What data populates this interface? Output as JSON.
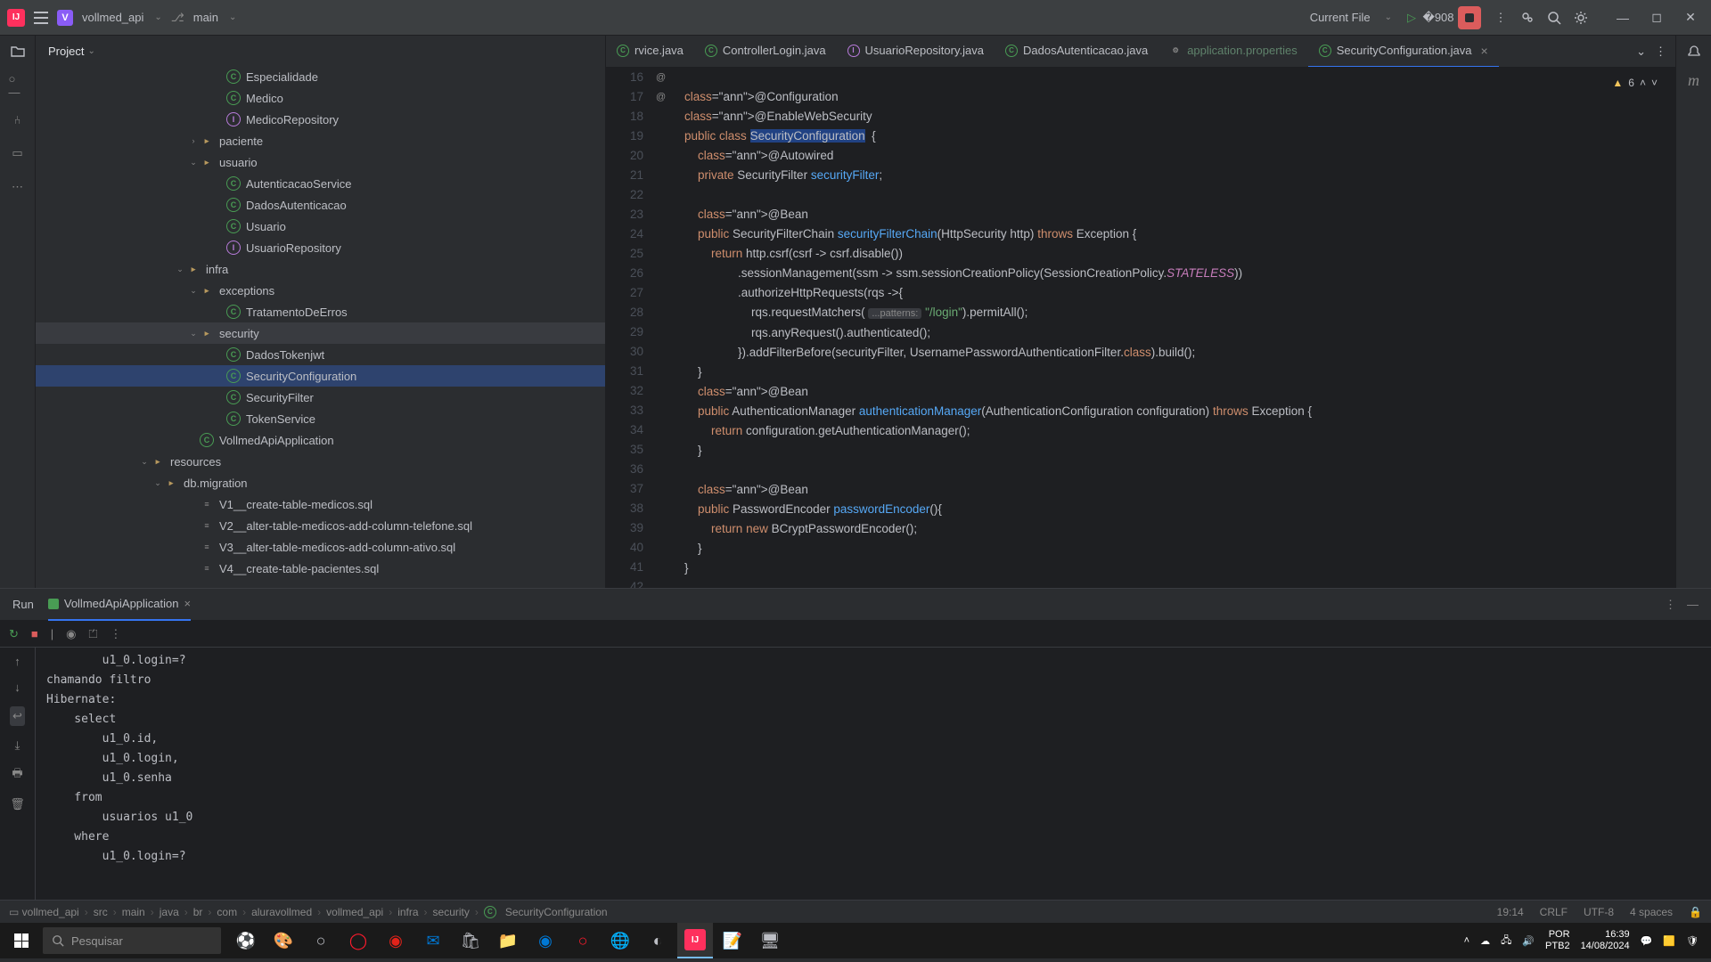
{
  "titlebar": {
    "project": "vollmed_api",
    "branch": "main",
    "run_config": "Current File"
  },
  "panel": {
    "title": "Project"
  },
  "tree": [
    {
      "ind": 200,
      "icon": "class",
      "label": "Especialidade"
    },
    {
      "ind": 200,
      "icon": "class",
      "label": "Medico"
    },
    {
      "ind": 200,
      "icon": "iface",
      "label": "MedicoRepository"
    },
    {
      "ind": 170,
      "chev": "›",
      "icon": "pkg",
      "label": "paciente"
    },
    {
      "ind": 170,
      "chev": "⌄",
      "icon": "pkg",
      "label": "usuario"
    },
    {
      "ind": 200,
      "icon": "class",
      "label": "AutenticacaoService"
    },
    {
      "ind": 200,
      "icon": "class",
      "label": "DadosAutenticacao"
    },
    {
      "ind": 200,
      "icon": "class",
      "label": "Usuario"
    },
    {
      "ind": 200,
      "icon": "iface",
      "label": "UsuarioRepository"
    },
    {
      "ind": 155,
      "chev": "⌄",
      "icon": "pkg",
      "label": "infra"
    },
    {
      "ind": 170,
      "chev": "⌄",
      "icon": "pkg",
      "label": "exceptions"
    },
    {
      "ind": 200,
      "icon": "class",
      "label": "TratamentoDeErros"
    },
    {
      "ind": 170,
      "chev": "⌄",
      "icon": "pkg",
      "label": "security",
      "hl": true
    },
    {
      "ind": 200,
      "icon": "class",
      "label": "DadosTokenjwt"
    },
    {
      "ind": 200,
      "icon": "class",
      "label": "SecurityConfiguration",
      "sel": true
    },
    {
      "ind": 200,
      "icon": "class",
      "label": "SecurityFilter"
    },
    {
      "ind": 200,
      "icon": "class",
      "label": "TokenService"
    },
    {
      "ind": 170,
      "icon": "class",
      "label": "VollmedApiApplication"
    },
    {
      "ind": 115,
      "chev": "⌄",
      "icon": "dir",
      "label": "resources"
    },
    {
      "ind": 130,
      "chev": "⌄",
      "icon": "dir",
      "label": "db.migration"
    },
    {
      "ind": 170,
      "icon": "file",
      "label": "V1__create-table-medicos.sql"
    },
    {
      "ind": 170,
      "icon": "file",
      "label": "V2__alter-table-medicos-add-column-telefone.sql"
    },
    {
      "ind": 170,
      "icon": "file",
      "label": "V3__alter-table-medicos-add-column-ativo.sql"
    },
    {
      "ind": 170,
      "icon": "file",
      "label": "V4__create-table-pacientes.sql"
    }
  ],
  "tabs": [
    {
      "icon": "class",
      "label": "rvice.java"
    },
    {
      "icon": "class",
      "label": "ControllerLogin.java"
    },
    {
      "icon": "iface",
      "label": "UsuarioRepository.java"
    },
    {
      "icon": "class",
      "label": "DadosAutenticacao.java"
    },
    {
      "icon": "prop",
      "label": "application.properties"
    },
    {
      "icon": "class",
      "label": "SecurityConfiguration.java",
      "active": true
    }
  ],
  "warnings": "6",
  "code": {
    "start": 16,
    "lines": [
      "",
      "@Configuration",
      "@EnableWebSecurity",
      "public class SecurityConfiguration  {",
      "    @Autowired",
      "    private SecurityFilter securityFilter;",
      "",
      "    @Bean",
      "    public SecurityFilterChain securityFilterChain(HttpSecurity http) throws Exception {",
      "        return http.csrf(csrf -> csrf.disable())",
      "                .sessionManagement(ssm -> ssm.sessionCreationPolicy(SessionCreationPolicy.STATELESS))",
      "                .authorizeHttpRequests(rqs ->{",
      "                    rqs.requestMatchers( ...patterns: \"/login\").permitAll();",
      "                    rqs.anyRequest().authenticated();",
      "                }).addFilterBefore(securityFilter, UsernamePasswordAuthenticationFilter.class).build();",
      "    }",
      "    @Bean",
      "    public AuthenticationManager authenticationManager(AuthenticationConfiguration configuration) throws Exception {",
      "        return configuration.getAuthenticationManager();",
      "    }",
      "",
      "    @Bean",
      "    public PasswordEncoder passwordEncoder(){",
      "        return new BCryptPasswordEncoder();",
      "    }",
      "}",
      ""
    ]
  },
  "run": {
    "tab": "Run",
    "app": "VollmedApiApplication",
    "console": "        u1_0.login=?\nchamando filtro\nHibernate: \n    select\n        u1_0.id,\n        u1_0.login,\n        u1_0.senha \n    from\n        usuarios u1_0 \n    where\n        u1_0.login=?"
  },
  "breadcrumbs": [
    "vollmed_api",
    "src",
    "main",
    "java",
    "br",
    "com",
    "aluravollmed",
    "vollmed_api",
    "infra",
    "security",
    "SecurityConfiguration"
  ],
  "status": {
    "pos": "19:14",
    "sep": "CRLF",
    "enc": "UTF-8",
    "indent": "4 spaces"
  },
  "taskbar": {
    "search": "Pesquisar",
    "lang": "POR",
    "kb": "PTB2",
    "time": "16:39",
    "date": "14/08/2024"
  }
}
